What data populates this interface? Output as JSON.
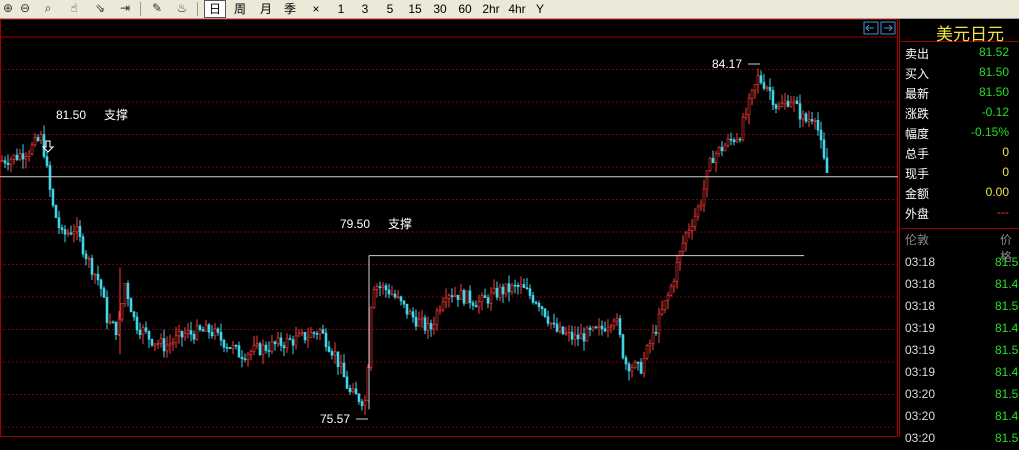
{
  "toolbar": {
    "icons": [
      "zoom-in-icon",
      "zoom-out-icon",
      "cursor-icon",
      "export-icon",
      "indicator-icon",
      "draw-icon",
      "alert-icon"
    ],
    "periods": [
      "日",
      "周",
      "月",
      "季",
      "×",
      "1",
      "3",
      "5",
      "15",
      "30",
      "60",
      "2hr",
      "4hr",
      "Y"
    ],
    "selected_period": "日"
  },
  "chart_data": {
    "type": "candlestick",
    "annotations": [
      {
        "price_label": "81.50",
        "text": "支撑"
      },
      {
        "price_label": "79.50",
        "text": "支撑"
      }
    ],
    "high_label": "84.17",
    "low_label": "75.57",
    "current_price": 81.5,
    "support_lines": [
      81.5,
      79.5
    ],
    "ylim": [
      74.9,
      85.5
    ]
  },
  "quote": {
    "title": "美元日元",
    "rows": [
      {
        "label": "卖出",
        "value": "81.52",
        "color": "#22e022"
      },
      {
        "label": "买入",
        "value": "81.50",
        "color": "#22e022"
      },
      {
        "label": "最新",
        "value": "81.50",
        "color": "#22e022"
      },
      {
        "label": "涨跌",
        "value": "-0.12",
        "color": "#22e022"
      },
      {
        "label": "幅度",
        "value": "-0.15%",
        "color": "#22e022"
      },
      {
        "label": "总手",
        "value": "0",
        "color": "#f0e44a"
      },
      {
        "label": "现手",
        "value": "0",
        "color": "#f0e44a"
      },
      {
        "label": "金额",
        "value": "0.00",
        "color": "#f0e44a"
      },
      {
        "label": "外盘",
        "value": "---",
        "color": "#ff3333"
      }
    ]
  },
  "ticks": {
    "headers": [
      "伦敦",
      "价格"
    ],
    "rows": [
      {
        "time": "03:18",
        "price": "81.5"
      },
      {
        "time": "03:18",
        "price": "81.4"
      },
      {
        "time": "03:18",
        "price": "81.5"
      },
      {
        "time": "03:19",
        "price": "81.4"
      },
      {
        "time": "03:19",
        "price": "81.5"
      },
      {
        "time": "03:19",
        "price": "81.4"
      },
      {
        "time": "03:20",
        "price": "81.5"
      },
      {
        "time": "03:20",
        "price": "81.4"
      },
      {
        "time": "03:20",
        "price": "81.5"
      }
    ]
  }
}
